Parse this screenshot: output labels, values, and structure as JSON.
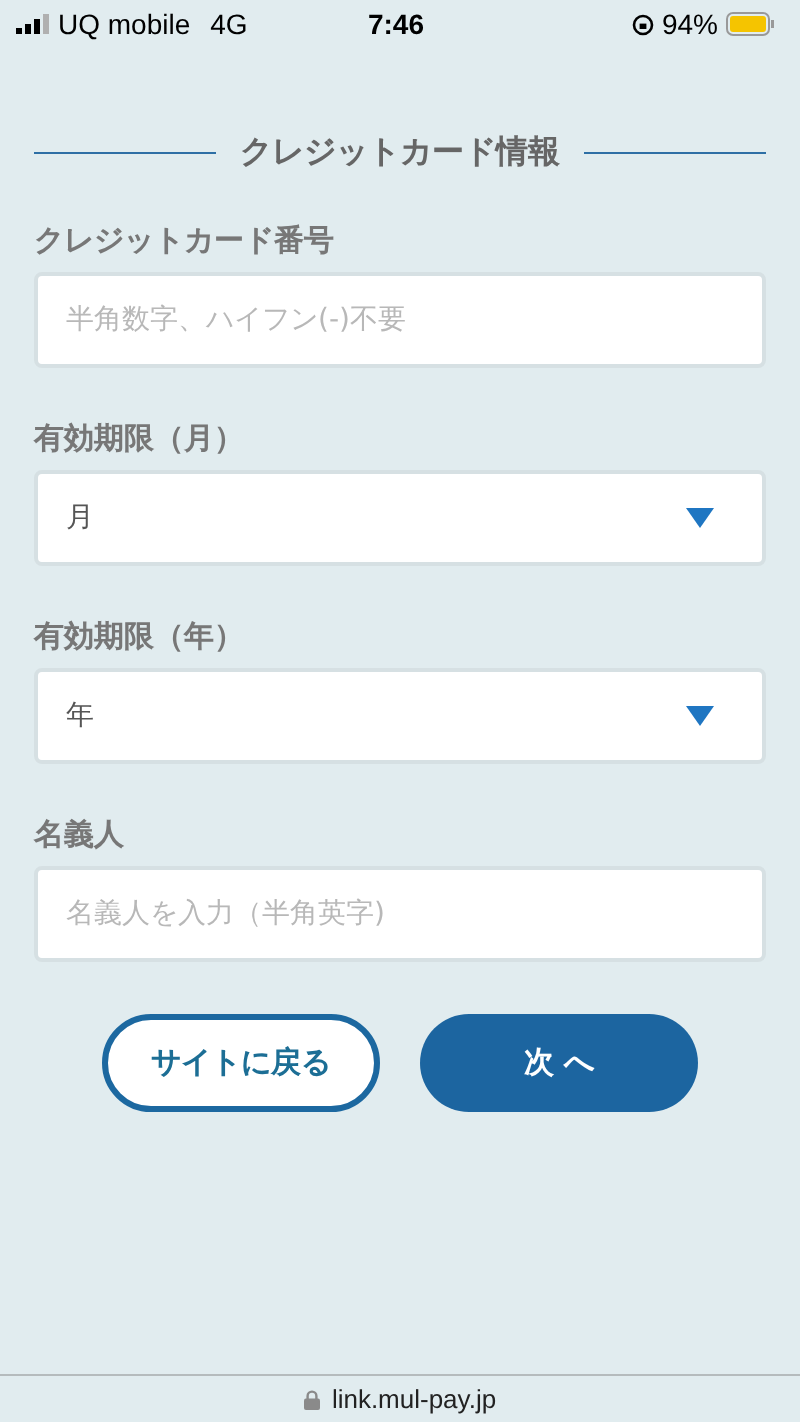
{
  "status_bar": {
    "carrier": "UQ mobile",
    "network": "4G",
    "time": "7:46",
    "battery": "94%"
  },
  "section_title": "クレジットカード情報",
  "fields": [
    {
      "kind": "text",
      "label": "クレジットカード番号",
      "placeholder": "半角数字、ハイフン(-)不要"
    },
    {
      "kind": "select",
      "label": "有効期限（月）",
      "value": "月"
    },
    {
      "kind": "select",
      "label": "有効期限（年）",
      "value": "年"
    },
    {
      "kind": "text",
      "label": "名義人",
      "placeholder": "名義人を入力（半角英字)"
    }
  ],
  "buttons": [
    {
      "kind": "secondary",
      "label": "サイトに戻る"
    },
    {
      "kind": "primary",
      "label": "次 へ"
    }
  ],
  "address_bar": {
    "url": "link.mul-pay.jp"
  }
}
